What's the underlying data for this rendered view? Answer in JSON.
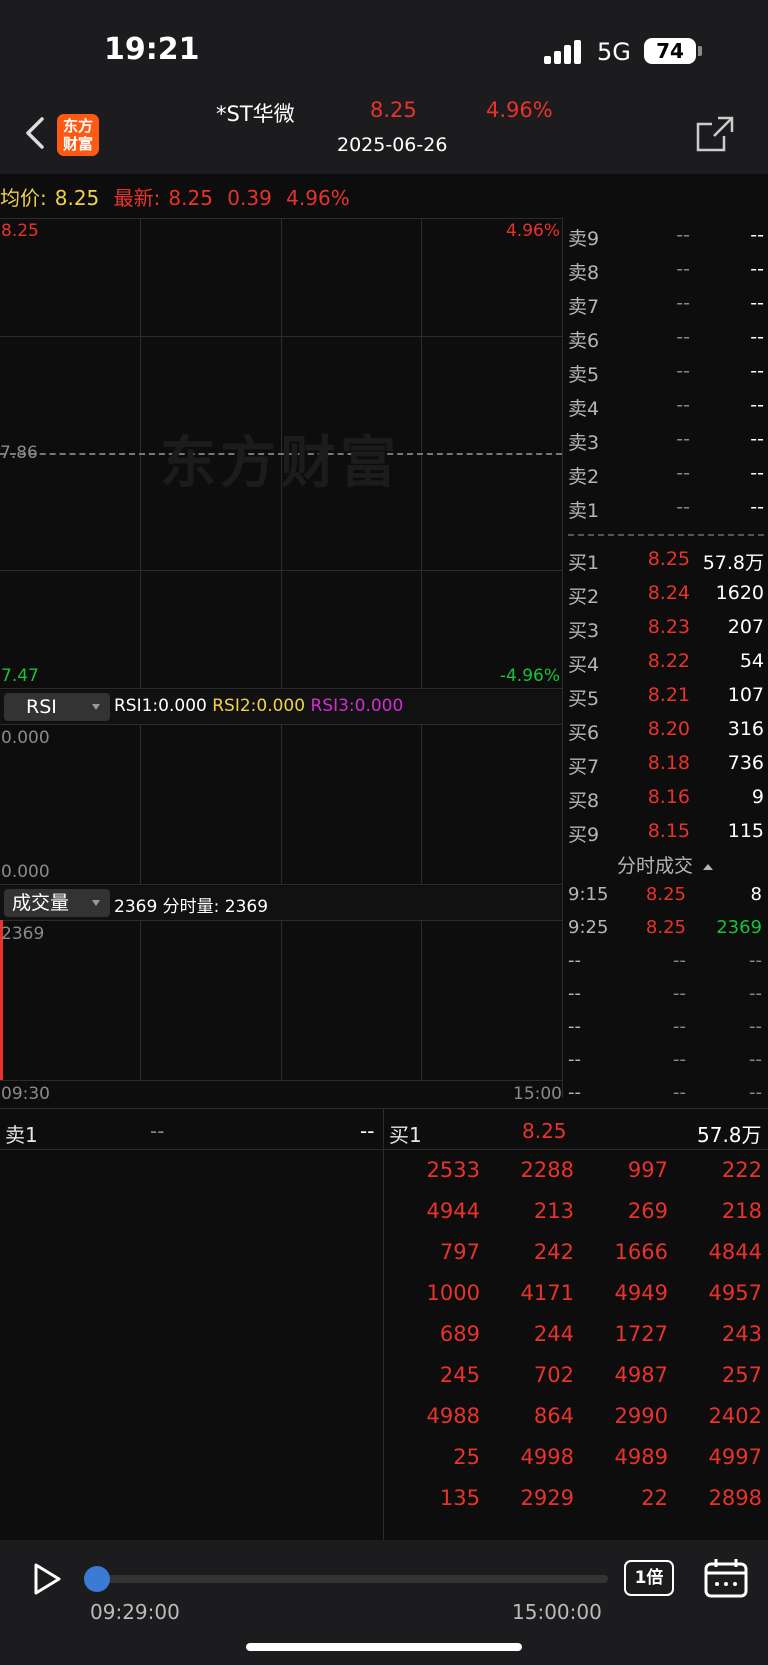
{
  "status_bar": {
    "time": "19:21",
    "network": "5G",
    "battery": "74"
  },
  "header": {
    "logo_line1": "东方",
    "logo_line2": "财富",
    "stock_name": "*ST华微",
    "price": "8.25",
    "change_pct": "4.96%",
    "date": "2025-06-26"
  },
  "info_line": {
    "avg_label": "均价:",
    "avg_value": "8.25",
    "latest_label": "最新:",
    "latest_value": "8.25",
    "change": "0.39",
    "change_pct": "4.96%"
  },
  "price_chart": {
    "top_price": "8.25",
    "top_pct": "4.96%",
    "mid_price": "7.86",
    "bottom_price": "7.47",
    "bottom_pct": "-4.96%",
    "watermark": "东方财富"
  },
  "rsi": {
    "button": "RSI",
    "rsi1": "RSI1:0.000",
    "rsi2": "RSI2:0.000",
    "rsi3": "RSI3:0.000",
    "top": "0.000",
    "bottom": "0.000"
  },
  "volume": {
    "button": "成交量",
    "summary": "2369 分时量: 2369",
    "top": "2369",
    "x_start": "09:30",
    "x_end": "15:00",
    "bar_value": 2369
  },
  "order_book": {
    "asks": [
      {
        "label": "卖9",
        "price": "--",
        "volume": "--"
      },
      {
        "label": "卖8",
        "price": "--",
        "volume": "--"
      },
      {
        "label": "卖7",
        "price": "--",
        "volume": "--"
      },
      {
        "label": "卖6",
        "price": "--",
        "volume": "--"
      },
      {
        "label": "卖5",
        "price": "--",
        "volume": "--"
      },
      {
        "label": "卖4",
        "price": "--",
        "volume": "--"
      },
      {
        "label": "卖3",
        "price": "--",
        "volume": "--"
      },
      {
        "label": "卖2",
        "price": "--",
        "volume": "--"
      },
      {
        "label": "卖1",
        "price": "--",
        "volume": "--"
      }
    ],
    "bids": [
      {
        "label": "买1",
        "price": "8.25",
        "volume": "57.8万"
      },
      {
        "label": "买2",
        "price": "8.24",
        "volume": "1620"
      },
      {
        "label": "买3",
        "price": "8.23",
        "volume": "207"
      },
      {
        "label": "买4",
        "price": "8.22",
        "volume": "54"
      },
      {
        "label": "买5",
        "price": "8.21",
        "volume": "107"
      },
      {
        "label": "买6",
        "price": "8.20",
        "volume": "316"
      },
      {
        "label": "买7",
        "price": "8.18",
        "volume": "736"
      },
      {
        "label": "买8",
        "price": "8.16",
        "volume": "9"
      },
      {
        "label": "买9",
        "price": "8.15",
        "volume": "115"
      }
    ]
  },
  "trades": {
    "title": "分时成交",
    "rows": [
      {
        "time": "9:15",
        "price": "8.25",
        "volume": "8",
        "vol_color": "white"
      },
      {
        "time": "9:25",
        "price": "8.25",
        "volume": "2369",
        "vol_color": "green"
      },
      {
        "time": "--",
        "price": "--",
        "volume": "--",
        "vol_color": "gray"
      },
      {
        "time": "--",
        "price": "--",
        "volume": "--",
        "vol_color": "gray"
      },
      {
        "time": "--",
        "price": "--",
        "volume": "--",
        "vol_color": "gray"
      },
      {
        "time": "--",
        "price": "--",
        "volume": "--",
        "vol_color": "gray"
      },
      {
        "time": "--",
        "price": "--",
        "volume": "--",
        "vol_color": "gray"
      }
    ]
  },
  "level1": {
    "ask_label": "卖1",
    "ask_price": "--",
    "ask_volume": "--",
    "bid_label": "买1",
    "bid_price": "8.25",
    "bid_volume": "57.8万"
  },
  "queue": [
    [
      "2533",
      "2288",
      "997",
      "222"
    ],
    [
      "4944",
      "213",
      "269",
      "218"
    ],
    [
      "797",
      "242",
      "1666",
      "4844"
    ],
    [
      "1000",
      "4171",
      "4949",
      "4957"
    ],
    [
      "689",
      "244",
      "1727",
      "243"
    ],
    [
      "245",
      "702",
      "4987",
      "257"
    ],
    [
      "4988",
      "864",
      "2990",
      "2402"
    ],
    [
      "25",
      "4998",
      "4989",
      "4997"
    ],
    [
      "135",
      "2929",
      "22",
      "2898"
    ]
  ],
  "playback": {
    "start_time": "09:29:00",
    "end_time": "15:00:00",
    "speed": "1倍",
    "progress": 0
  },
  "colors": {
    "up": "#e8332c",
    "down": "#19c23a",
    "avg": "#f0d24a",
    "rsi3": "#d32dd4",
    "accent": "#3a7bd5"
  }
}
